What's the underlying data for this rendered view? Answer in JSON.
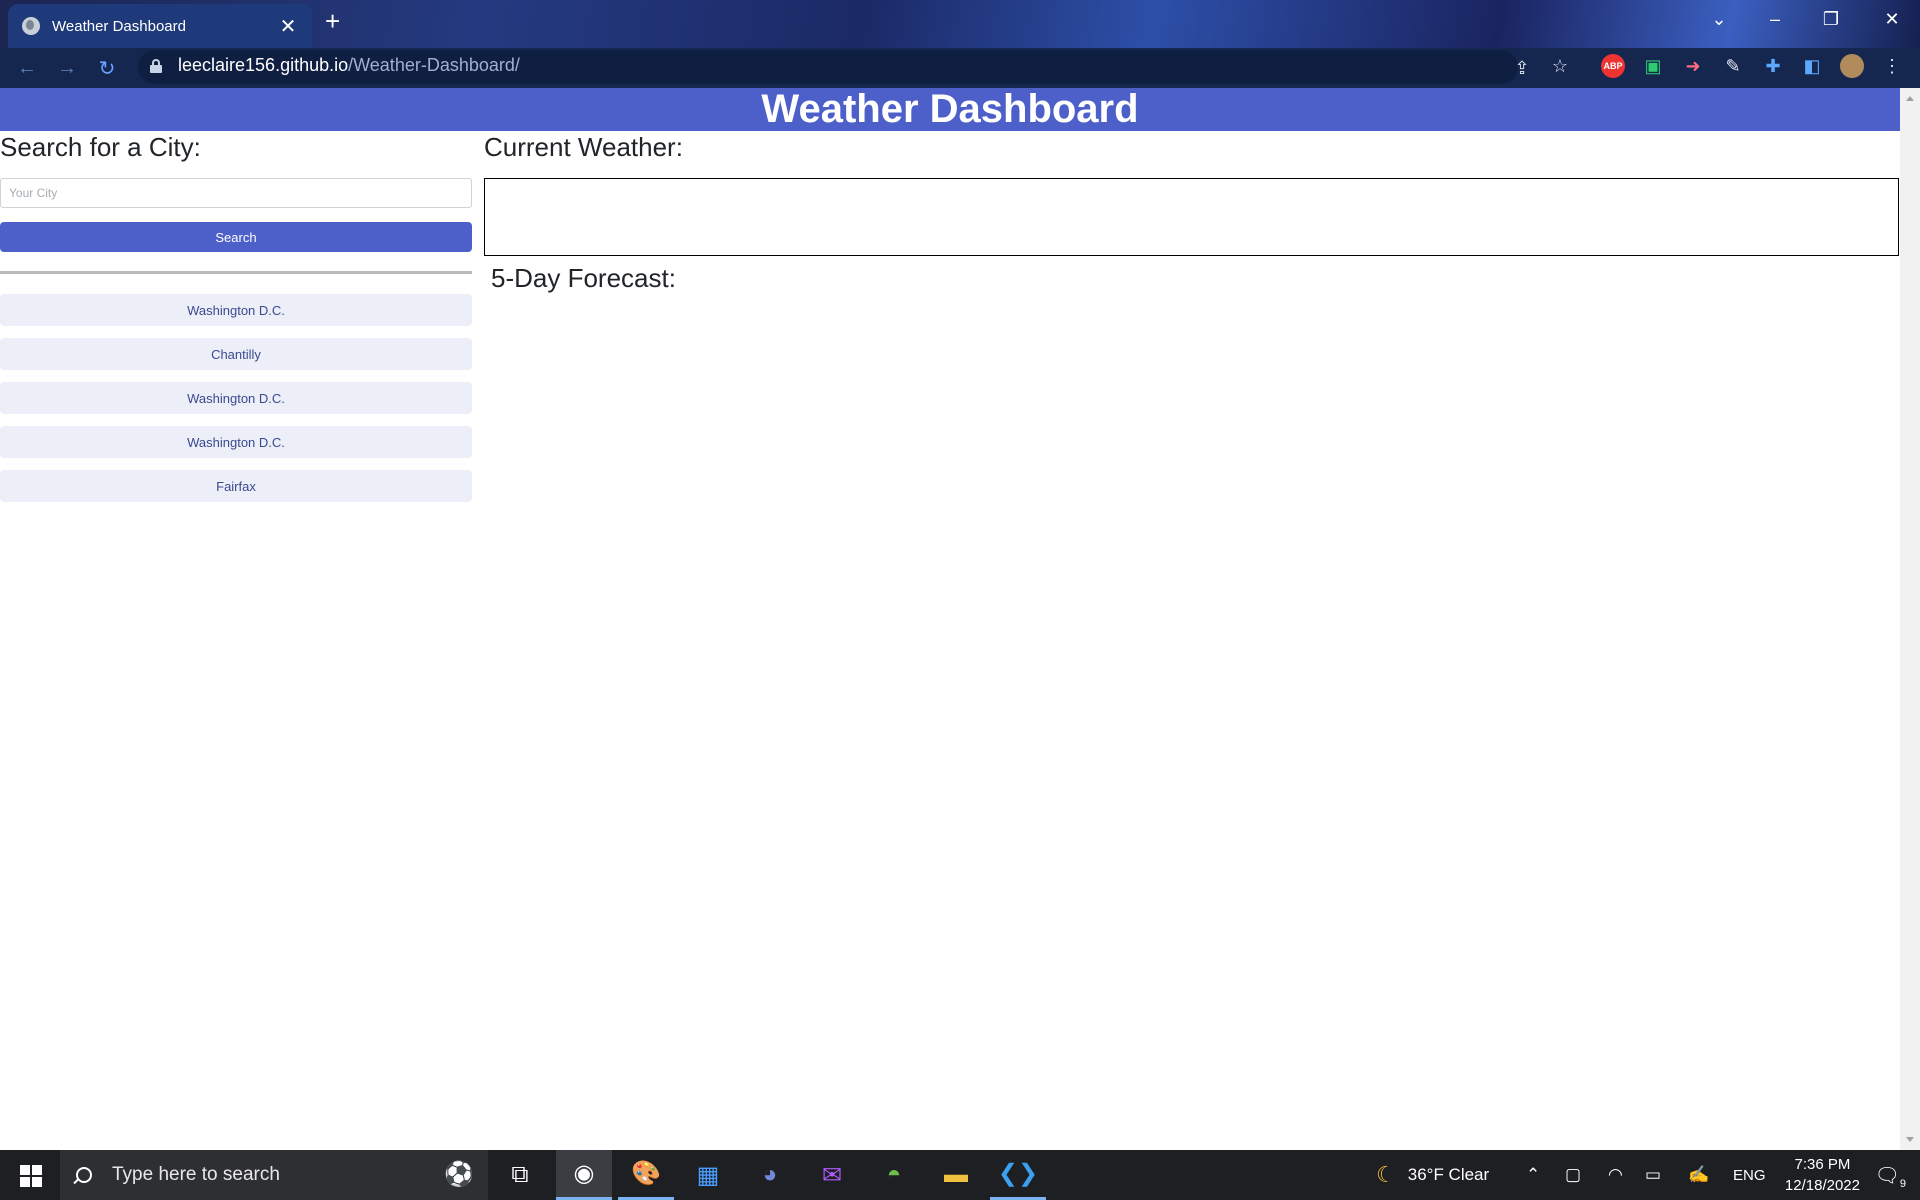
{
  "browser": {
    "tab_title": "Weather Dashboard",
    "url_host": "leeclaire156.github.io",
    "url_path": "/Weather-Dashboard/",
    "extensions": [
      "ABP"
    ]
  },
  "page": {
    "header_title": "Weather Dashboard",
    "search_heading": "Search for a City:",
    "city_placeholder": "Your City",
    "search_button": "Search",
    "history": [
      "Washington D.C.",
      "Chantilly",
      "Washington D.C.",
      "Washington D.C.",
      "Fairfax"
    ],
    "current_heading": "Current Weather:",
    "forecast_heading": "5-Day Forecast:"
  },
  "taskbar": {
    "search_placeholder": "Type here to search",
    "weather": "36°F  Clear",
    "language": "ENG",
    "time": "7:36 PM",
    "date": "12/18/2022",
    "notification_count": "9"
  }
}
